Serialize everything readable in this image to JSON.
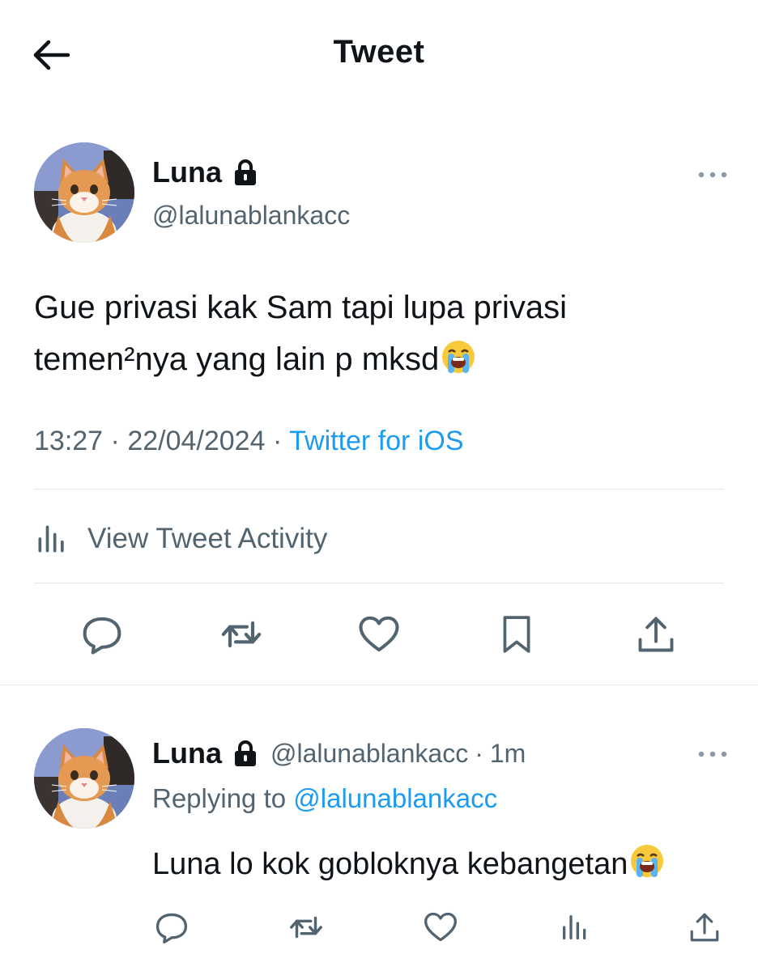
{
  "nav": {
    "title": "Tweet",
    "back_icon": "arrow-left-icon"
  },
  "tweet": {
    "author": {
      "name": "Luna",
      "handle": "@lalunablankacc",
      "locked": true
    },
    "text_line1": "Gue privasi kak Sam tapi lupa privasi",
    "text_line2": "temen²nya yang lain p mksd",
    "emoji": "loudly-crying-face-emoji",
    "time": "13:27",
    "date": "22/04/2024",
    "separator": "·",
    "source": "Twitter for iOS",
    "activity_label": "View Tweet Activity",
    "actions": [
      "reply-icon",
      "retweet-icon",
      "like-icon",
      "bookmark-icon",
      "share-icon"
    ]
  },
  "reply": {
    "author": {
      "name": "Luna",
      "handle": "@lalunablankacc",
      "locked": true
    },
    "time_ago": "1m",
    "separator": "·",
    "replying_prefix": "Replying to",
    "replying_to": "@lalunablankacc",
    "text": "Luna lo kok gobloknya kebangetan",
    "emoji": "loudly-crying-face-emoji",
    "actions": [
      "reply-icon",
      "retweet-icon",
      "like-icon",
      "views-icon",
      "share-icon"
    ]
  },
  "colors": {
    "text": "#0f1419",
    "secondary": "#536471",
    "accent": "#1d9bf0",
    "divider": "#e6e9eb",
    "icon": "#536471"
  }
}
